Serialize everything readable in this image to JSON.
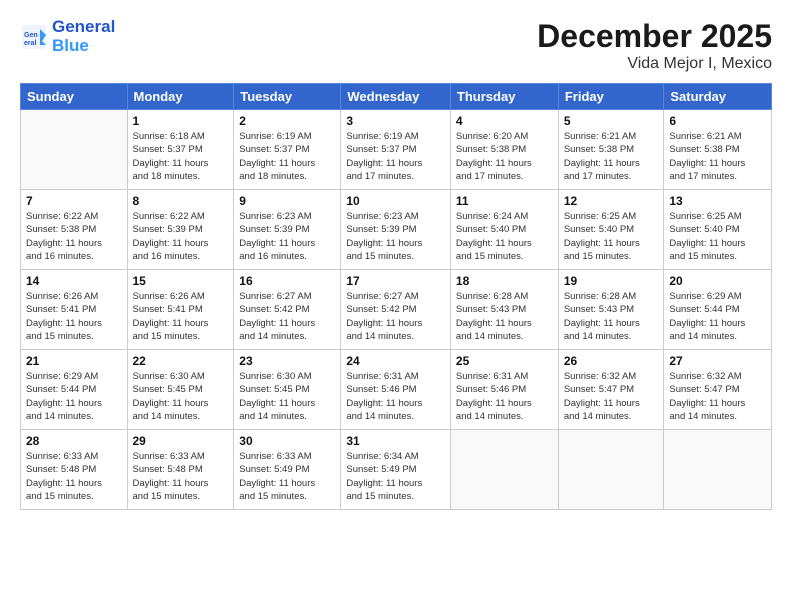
{
  "header": {
    "logo_line1": "General",
    "logo_line2": "Blue",
    "month": "December 2025",
    "location": "Vida Mejor I, Mexico"
  },
  "weekdays": [
    "Sunday",
    "Monday",
    "Tuesday",
    "Wednesday",
    "Thursday",
    "Friday",
    "Saturday"
  ],
  "weeks": [
    [
      {
        "day": "",
        "info": ""
      },
      {
        "day": "1",
        "info": "Sunrise: 6:18 AM\nSunset: 5:37 PM\nDaylight: 11 hours\nand 18 minutes."
      },
      {
        "day": "2",
        "info": "Sunrise: 6:19 AM\nSunset: 5:37 PM\nDaylight: 11 hours\nand 18 minutes."
      },
      {
        "day": "3",
        "info": "Sunrise: 6:19 AM\nSunset: 5:37 PM\nDaylight: 11 hours\nand 17 minutes."
      },
      {
        "day": "4",
        "info": "Sunrise: 6:20 AM\nSunset: 5:38 PM\nDaylight: 11 hours\nand 17 minutes."
      },
      {
        "day": "5",
        "info": "Sunrise: 6:21 AM\nSunset: 5:38 PM\nDaylight: 11 hours\nand 17 minutes."
      },
      {
        "day": "6",
        "info": "Sunrise: 6:21 AM\nSunset: 5:38 PM\nDaylight: 11 hours\nand 17 minutes."
      }
    ],
    [
      {
        "day": "7",
        "info": "Sunrise: 6:22 AM\nSunset: 5:38 PM\nDaylight: 11 hours\nand 16 minutes."
      },
      {
        "day": "8",
        "info": "Sunrise: 6:22 AM\nSunset: 5:39 PM\nDaylight: 11 hours\nand 16 minutes."
      },
      {
        "day": "9",
        "info": "Sunrise: 6:23 AM\nSunset: 5:39 PM\nDaylight: 11 hours\nand 16 minutes."
      },
      {
        "day": "10",
        "info": "Sunrise: 6:23 AM\nSunset: 5:39 PM\nDaylight: 11 hours\nand 15 minutes."
      },
      {
        "day": "11",
        "info": "Sunrise: 6:24 AM\nSunset: 5:40 PM\nDaylight: 11 hours\nand 15 minutes."
      },
      {
        "day": "12",
        "info": "Sunrise: 6:25 AM\nSunset: 5:40 PM\nDaylight: 11 hours\nand 15 minutes."
      },
      {
        "day": "13",
        "info": "Sunrise: 6:25 AM\nSunset: 5:40 PM\nDaylight: 11 hours\nand 15 minutes."
      }
    ],
    [
      {
        "day": "14",
        "info": "Sunrise: 6:26 AM\nSunset: 5:41 PM\nDaylight: 11 hours\nand 15 minutes."
      },
      {
        "day": "15",
        "info": "Sunrise: 6:26 AM\nSunset: 5:41 PM\nDaylight: 11 hours\nand 15 minutes."
      },
      {
        "day": "16",
        "info": "Sunrise: 6:27 AM\nSunset: 5:42 PM\nDaylight: 11 hours\nand 14 minutes."
      },
      {
        "day": "17",
        "info": "Sunrise: 6:27 AM\nSunset: 5:42 PM\nDaylight: 11 hours\nand 14 minutes."
      },
      {
        "day": "18",
        "info": "Sunrise: 6:28 AM\nSunset: 5:43 PM\nDaylight: 11 hours\nand 14 minutes."
      },
      {
        "day": "19",
        "info": "Sunrise: 6:28 AM\nSunset: 5:43 PM\nDaylight: 11 hours\nand 14 minutes."
      },
      {
        "day": "20",
        "info": "Sunrise: 6:29 AM\nSunset: 5:44 PM\nDaylight: 11 hours\nand 14 minutes."
      }
    ],
    [
      {
        "day": "21",
        "info": "Sunrise: 6:29 AM\nSunset: 5:44 PM\nDaylight: 11 hours\nand 14 minutes."
      },
      {
        "day": "22",
        "info": "Sunrise: 6:30 AM\nSunset: 5:45 PM\nDaylight: 11 hours\nand 14 minutes."
      },
      {
        "day": "23",
        "info": "Sunrise: 6:30 AM\nSunset: 5:45 PM\nDaylight: 11 hours\nand 14 minutes."
      },
      {
        "day": "24",
        "info": "Sunrise: 6:31 AM\nSunset: 5:46 PM\nDaylight: 11 hours\nand 14 minutes."
      },
      {
        "day": "25",
        "info": "Sunrise: 6:31 AM\nSunset: 5:46 PM\nDaylight: 11 hours\nand 14 minutes."
      },
      {
        "day": "26",
        "info": "Sunrise: 6:32 AM\nSunset: 5:47 PM\nDaylight: 11 hours\nand 14 minutes."
      },
      {
        "day": "27",
        "info": "Sunrise: 6:32 AM\nSunset: 5:47 PM\nDaylight: 11 hours\nand 14 minutes."
      }
    ],
    [
      {
        "day": "28",
        "info": "Sunrise: 6:33 AM\nSunset: 5:48 PM\nDaylight: 11 hours\nand 15 minutes."
      },
      {
        "day": "29",
        "info": "Sunrise: 6:33 AM\nSunset: 5:48 PM\nDaylight: 11 hours\nand 15 minutes."
      },
      {
        "day": "30",
        "info": "Sunrise: 6:33 AM\nSunset: 5:49 PM\nDaylight: 11 hours\nand 15 minutes."
      },
      {
        "day": "31",
        "info": "Sunrise: 6:34 AM\nSunset: 5:49 PM\nDaylight: 11 hours\nand 15 minutes."
      },
      {
        "day": "",
        "info": ""
      },
      {
        "day": "",
        "info": ""
      },
      {
        "day": "",
        "info": ""
      }
    ]
  ]
}
